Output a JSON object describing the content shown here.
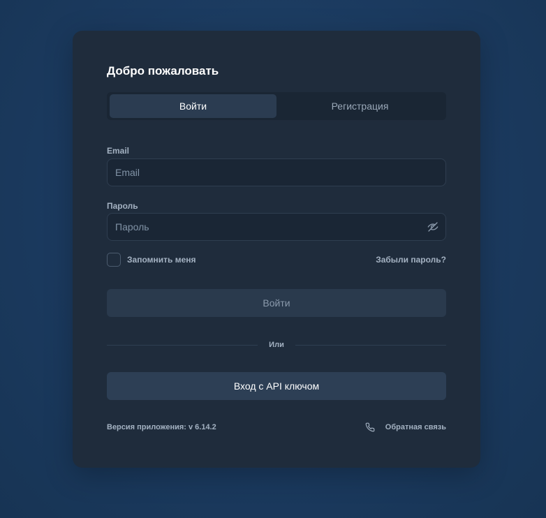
{
  "card": {
    "title": "Добро пожаловать"
  },
  "tabs": [
    {
      "label": "Войти",
      "active": true
    },
    {
      "label": "Регистрация",
      "active": false
    }
  ],
  "email": {
    "label": "Email",
    "placeholder": "Email",
    "value": ""
  },
  "password": {
    "label": "Пароль",
    "placeholder": "Пароль",
    "value": "",
    "toggle_icon": "eye-off-icon"
  },
  "remember": {
    "label": "Запомнить меня",
    "checked": false
  },
  "forgot_label": "Забыли пароль?",
  "login_button_label": "Войти",
  "divider_label": "Или",
  "api_button_label": "Вход с API ключом",
  "footer": {
    "version": "Версия приложения: v 6.14.2",
    "feedback_label": "Обратная связь",
    "feedback_icon": "phone-icon"
  },
  "colors": {
    "background": "#1b3a5f",
    "card": "#1f2c3c",
    "accent_text": "#a4b2c2"
  }
}
